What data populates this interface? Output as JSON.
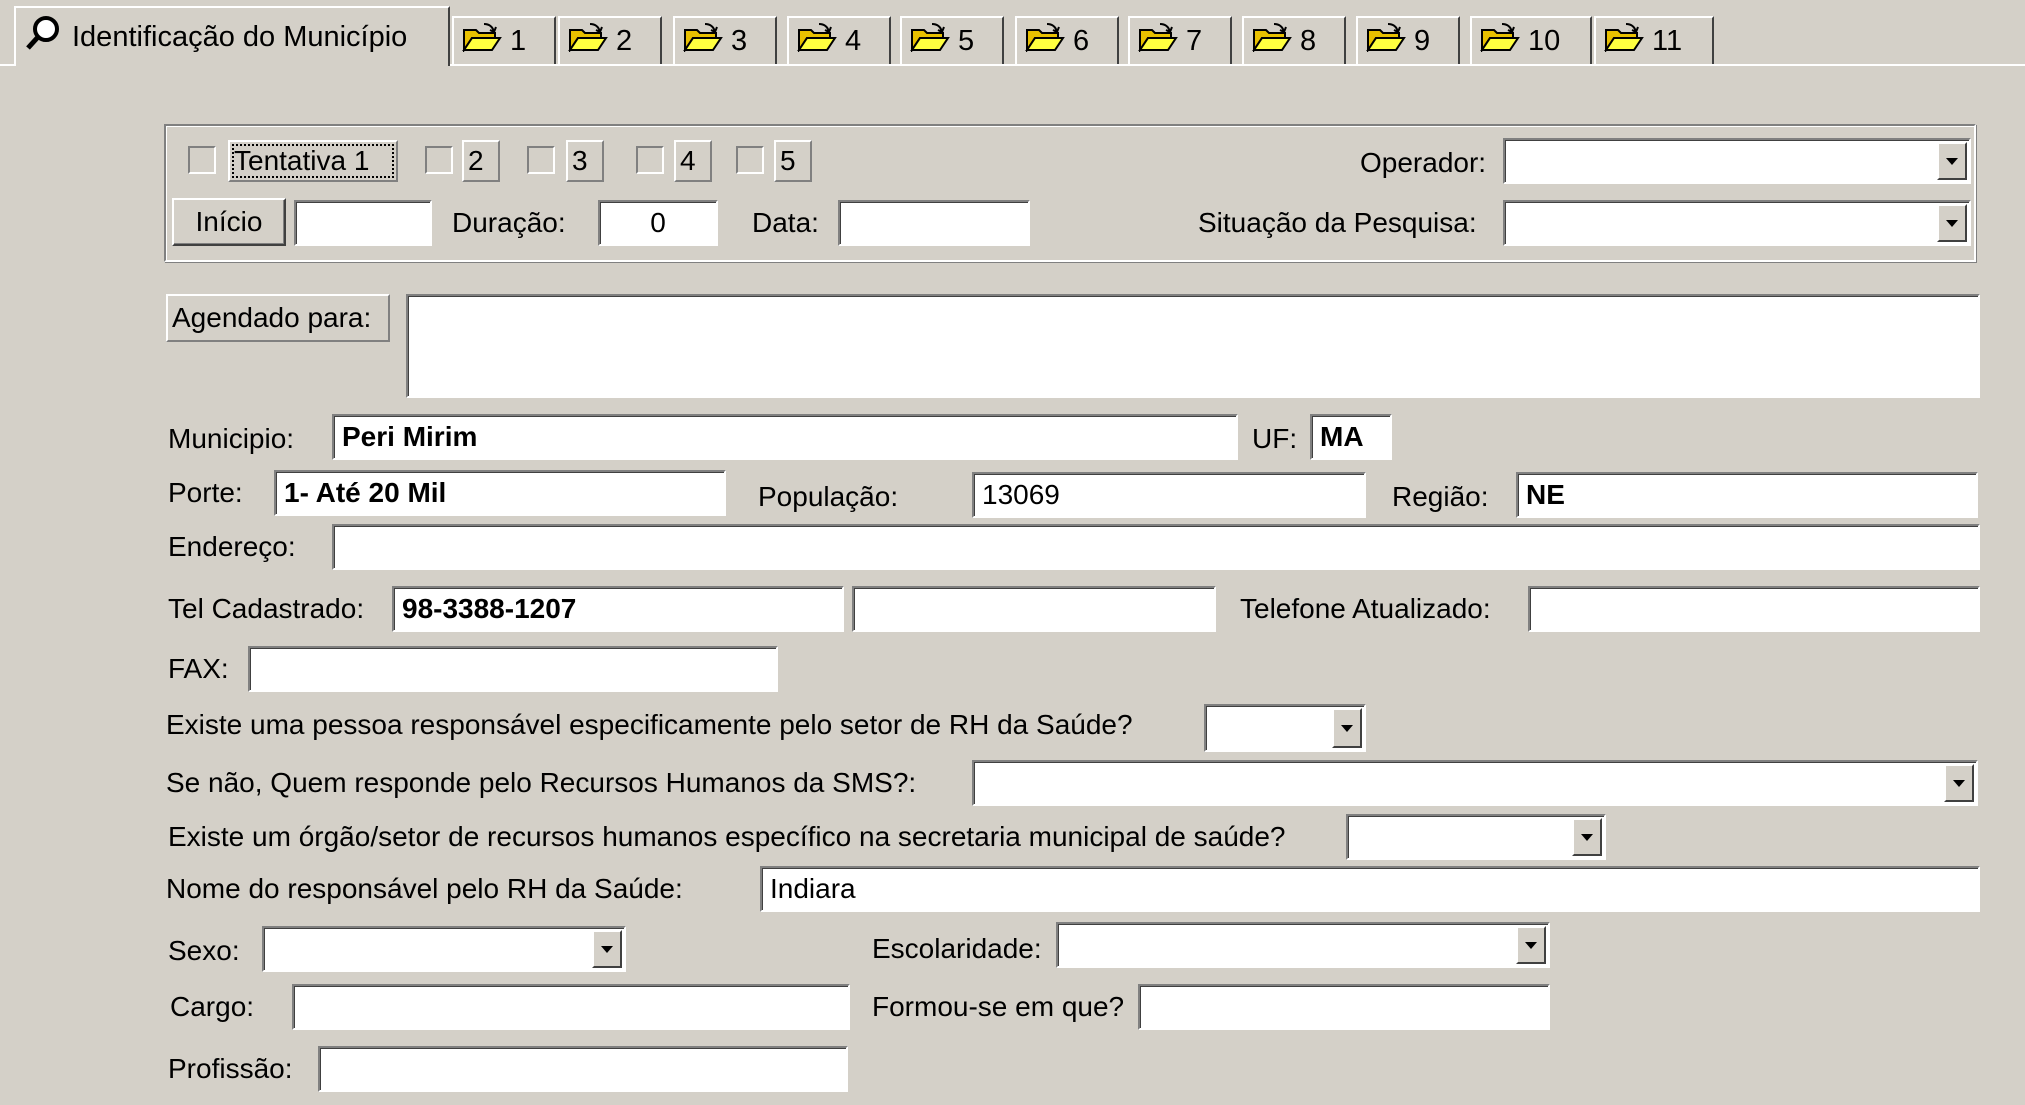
{
  "tabs": {
    "active_label": "Identificação do Município",
    "items": [
      "1",
      "2",
      "3",
      "4",
      "5",
      "6",
      "7",
      "8",
      "9",
      "10",
      "11"
    ]
  },
  "attempts": {
    "first_label": "Tentativa 1",
    "others": [
      "2",
      "3",
      "4",
      "5"
    ],
    "start_button": "Início",
    "start_value": "",
    "duration_label": "Duração:",
    "duration_value": "0",
    "date_label": "Data:",
    "date_value": "",
    "operator_label": "Operador:",
    "operator_value": "",
    "status_label": "Situação da Pesquisa:",
    "status_value": ""
  },
  "scheduled": {
    "label": "Agendado para:",
    "value": ""
  },
  "municipio": {
    "label": "Municipio:",
    "value": "Peri Mirim",
    "uf_label": "UF:",
    "uf_value": "MA"
  },
  "porte": {
    "label": "Porte:",
    "value": "1- Até 20 Mil",
    "populacao_label": "População:",
    "populacao_value": "13069",
    "regiao_label": "Região:",
    "regiao_value": "NE"
  },
  "endereco": {
    "label": "Endereço:",
    "value": ""
  },
  "telefone": {
    "label": "Tel Cadastrado:",
    "value": "98-3388-1207",
    "value2": "",
    "updated_label": "Telefone Atualizado:",
    "updated_value": ""
  },
  "fax": {
    "label": "FAX:",
    "value": ""
  },
  "q1": {
    "label": "Existe uma pessoa responsável especificamente pelo setor de RH da Saúde?",
    "value": ""
  },
  "q2": {
    "label": "Se não, Quem responde pelo  Recursos Humanos da SMS?:",
    "value": ""
  },
  "q3": {
    "label": "Existe um órgão/setor de recursos humanos específico na secretaria municipal de saúde?",
    "value": ""
  },
  "responsavel": {
    "label": "Nome do responsável pelo RH da Saúde:",
    "value": "Indiara"
  },
  "sexo": {
    "label": "Sexo:",
    "value": ""
  },
  "escolaridade": {
    "label": "Escolaridade:",
    "value": ""
  },
  "cargo": {
    "label": "Cargo:",
    "value": ""
  },
  "formou": {
    "label": "Formou-se em que?",
    "value": ""
  },
  "profissao": {
    "label": "Profissão:",
    "value": ""
  },
  "icons": {
    "tab_active": "magnifier-icon",
    "tab_other": "open-folder-icon"
  }
}
